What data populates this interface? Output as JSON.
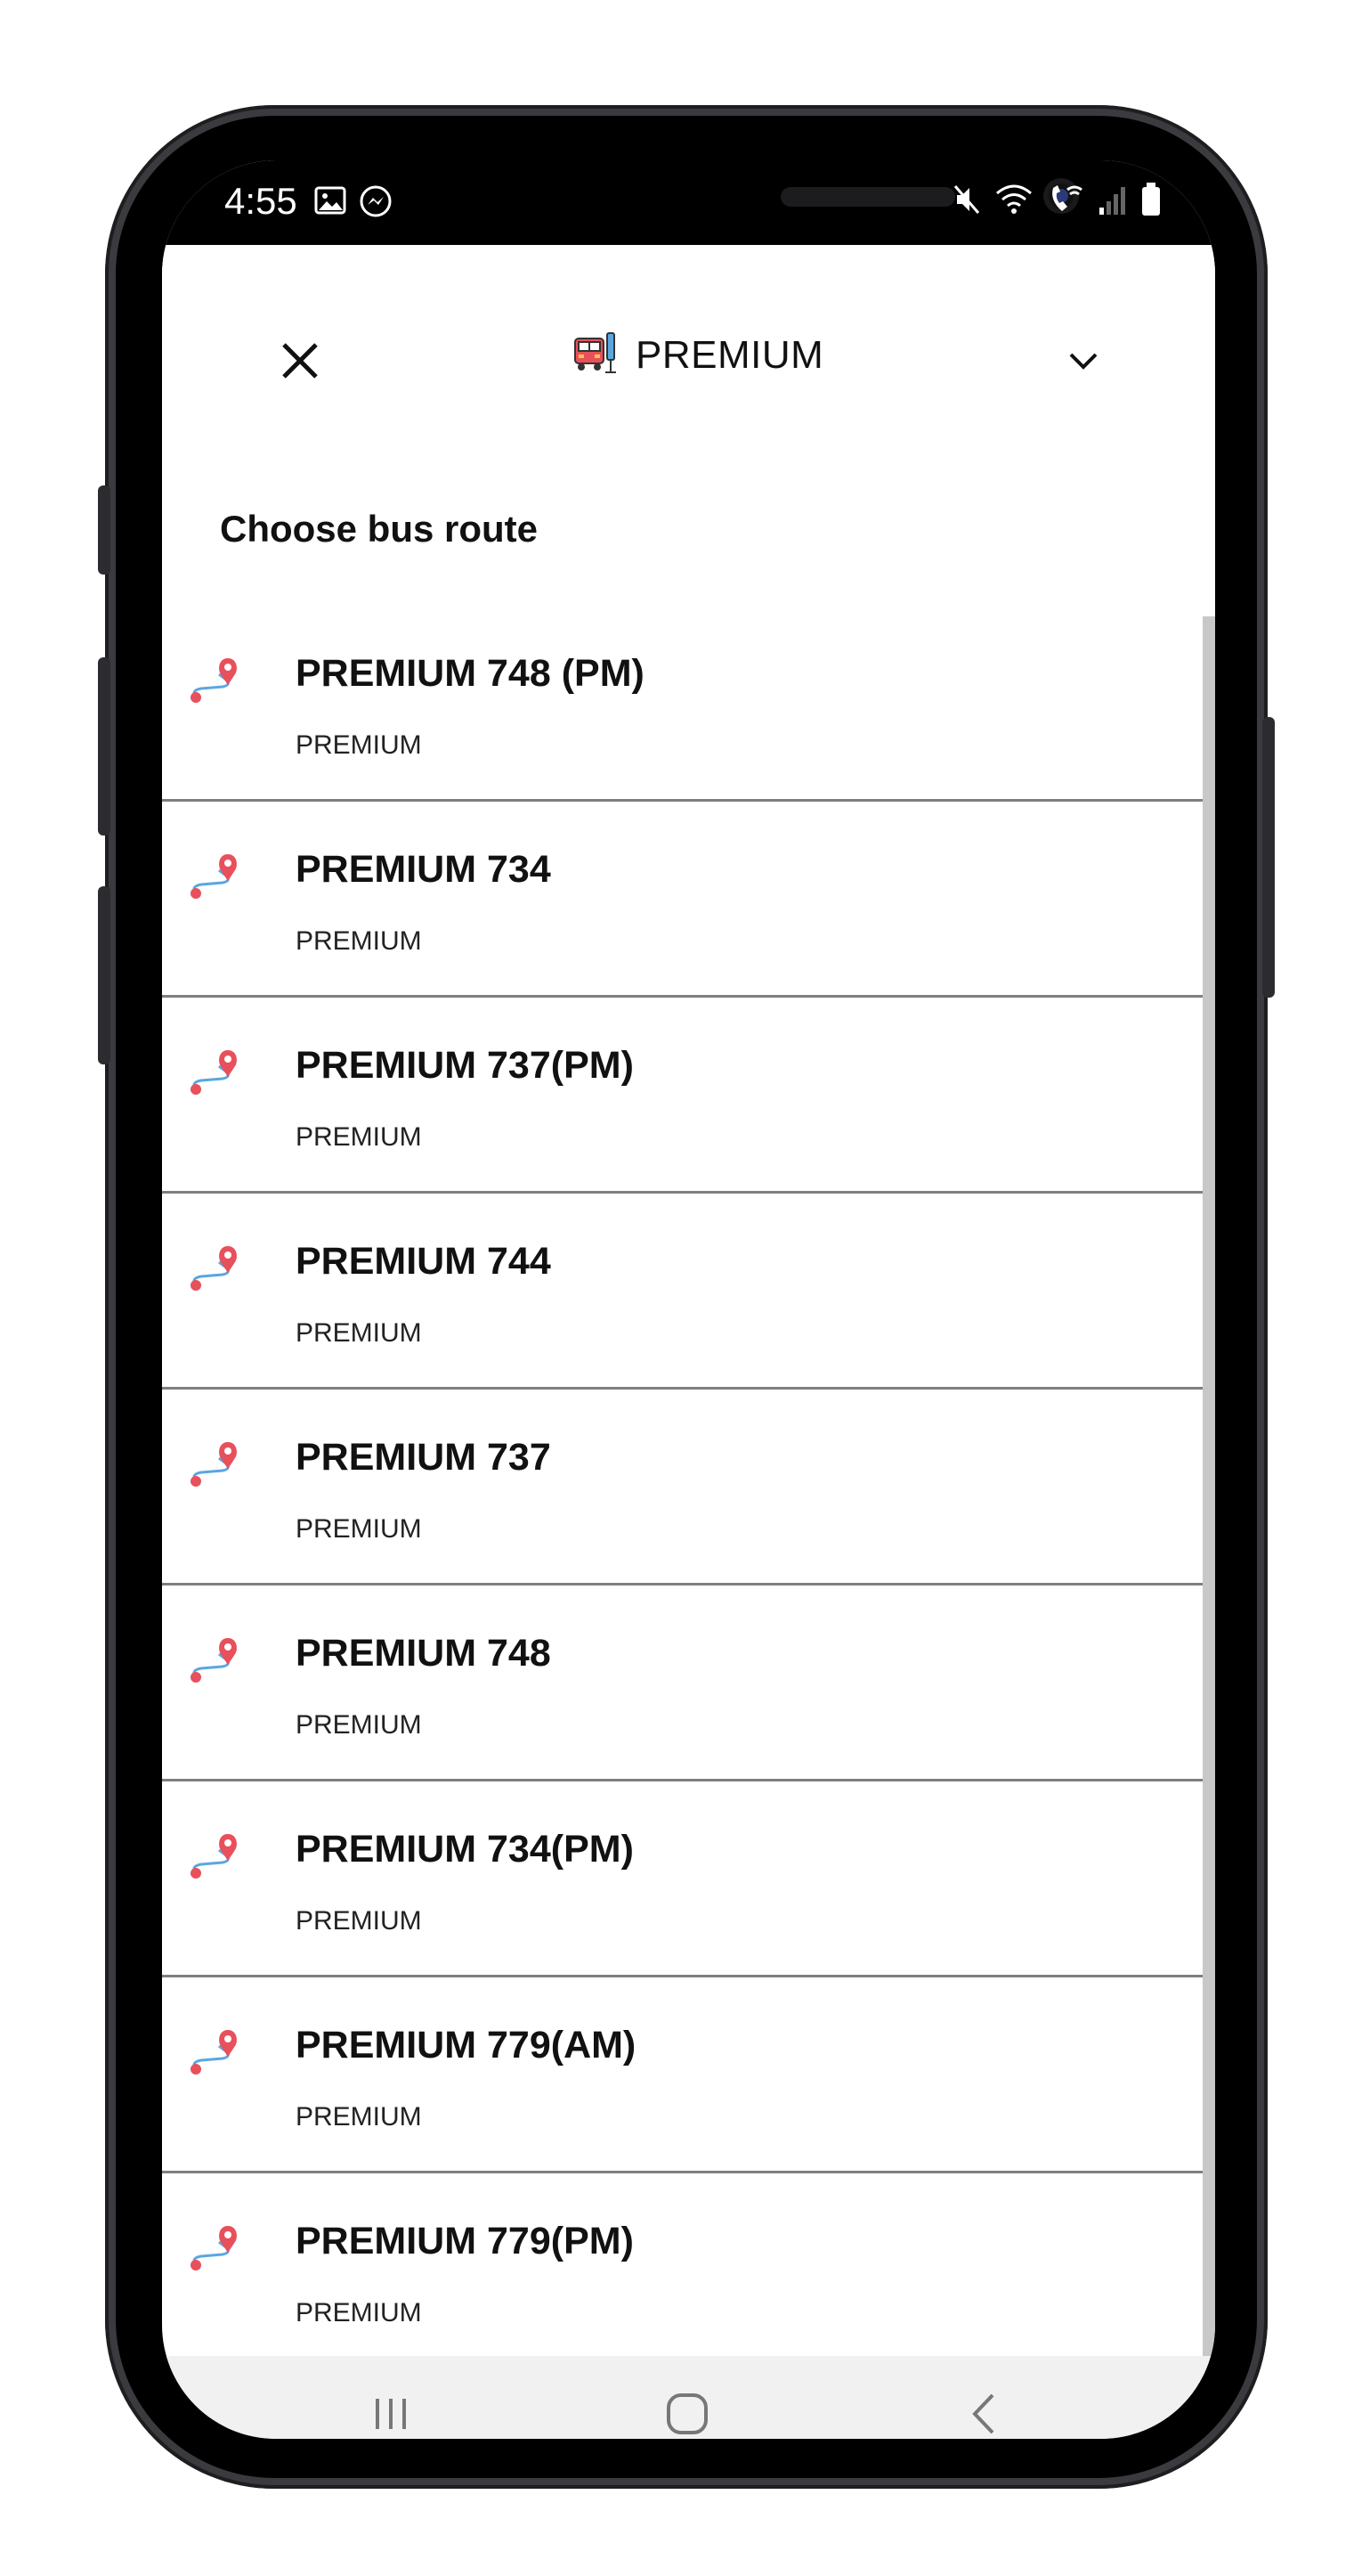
{
  "status_bar": {
    "time": "4:55",
    "left_icons": [
      "image-icon",
      "messenger-icon"
    ],
    "right_icons": [
      "mute-icon",
      "wifi-icon",
      "wifi-call-icon",
      "signal-icon",
      "battery-icon"
    ]
  },
  "header": {
    "title": "PREMIUM",
    "close_icon": "close-icon",
    "bus_icon": "bus-icon",
    "dropdown_icon": "chevron-down-icon"
  },
  "section_title": "Choose bus route",
  "routes": [
    {
      "name": "PREMIUM 748 (PM)",
      "category": "PREMIUM"
    },
    {
      "name": "PREMIUM 734",
      "category": "PREMIUM"
    },
    {
      "name": "PREMIUM 737(PM)",
      "category": "PREMIUM"
    },
    {
      "name": "PREMIUM 744",
      "category": "PREMIUM"
    },
    {
      "name": "PREMIUM 737",
      "category": "PREMIUM"
    },
    {
      "name": "PREMIUM 748",
      "category": "PREMIUM"
    },
    {
      "name": "PREMIUM 734(PM)",
      "category": "PREMIUM"
    },
    {
      "name": "PREMIUM 779(AM)",
      "category": "PREMIUM"
    },
    {
      "name": "PREMIUM 779(PM)",
      "category": "PREMIUM"
    }
  ],
  "nav_bar": [
    "recent-apps-icon",
    "home-icon",
    "back-icon"
  ],
  "colors": {
    "pin": "#e8505b",
    "path": "#5aa7e0",
    "divider": "#7f7f7f",
    "navbar_bg": "#f1f1f1"
  }
}
